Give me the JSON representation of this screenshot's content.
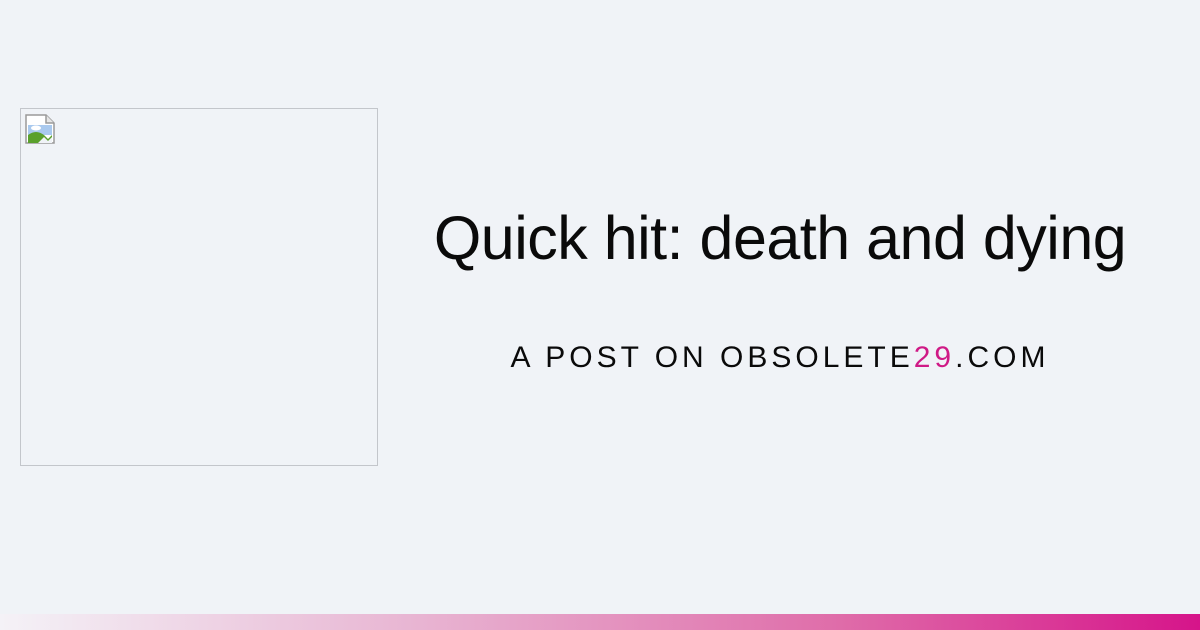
{
  "post": {
    "title": "Quick hit: death and dying",
    "subtitle_prefix": "A POST ON OBSOLETE",
    "subtitle_highlight": "29",
    "subtitle_suffix": ".COM"
  },
  "icons": {
    "broken_image": "broken-image-icon"
  },
  "colors": {
    "background": "#f0f3f7",
    "accent": "#cf1a86",
    "gradient_start": "#f4f2f7",
    "gradient_end": "#d6148a"
  }
}
